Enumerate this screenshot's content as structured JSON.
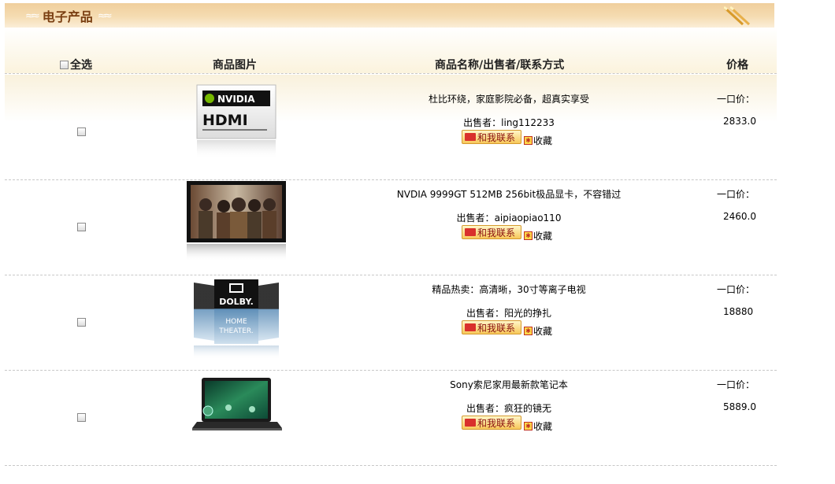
{
  "header": {
    "title": "电子产品",
    "swirl": "≈≈"
  },
  "columns": {
    "select_all": "全选",
    "image": "商品图片",
    "name": "商品名称/出售者/联系方式",
    "price": "价格"
  },
  "icons": {
    "pencils": "pencils-icon",
    "contact": "contact-me-icon",
    "favorite": "favorite-star-icon"
  },
  "colors": {
    "header_bg": "#f0cf9c",
    "title": "#7a3f12",
    "contact_text": "#8a1010"
  },
  "products": [
    {
      "name": "杜比环绕，家庭影院必备，超真实享受",
      "seller_label": "出售者：",
      "seller": "ling112233",
      "contact_label": "和我联系",
      "favorite_label": "收藏",
      "price_label": "一口价：",
      "price": "2833.0",
      "image": "nvidia-hdmi-logo"
    },
    {
      "name": "NVDIA 9999GT 512MB 256bit极品显卡，不容错过",
      "seller_label": "出售者：",
      "seller": "aipiaopiao110",
      "contact_label": "和我联系",
      "favorite_label": "收藏",
      "price_label": "一口价：",
      "price": "2460.0",
      "image": "movie-screen-photo"
    },
    {
      "name": "精品热卖：高清晰，30寸等离子电视",
      "seller_label": "出售者：",
      "seller": "阳光的挣扎",
      "contact_label": "和我联系",
      "favorite_label": "收藏",
      "price_label": "一口价：",
      "price": "18880",
      "image": "dolby-home-theater-logo"
    },
    {
      "name": "Sony索尼家用最新款笔记本",
      "seller_label": "出售者：",
      "seller": "疯狂的镜无",
      "contact_label": "和我联系",
      "favorite_label": "收藏",
      "price_label": "一口价：",
      "price": "5889.0",
      "image": "lenovo-laptop-photo"
    }
  ]
}
